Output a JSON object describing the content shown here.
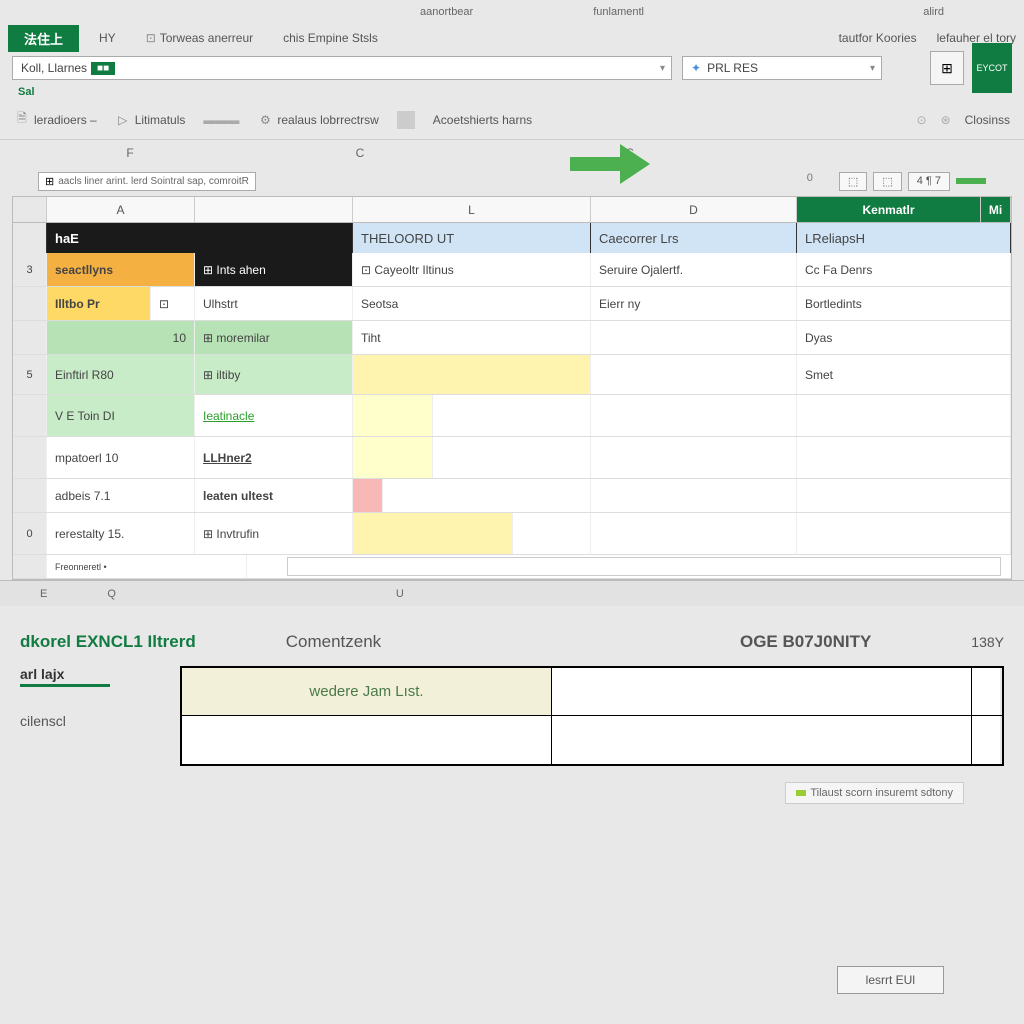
{
  "topTabs": {
    "t1": "",
    "t2": "",
    "t3": "aanortbear",
    "t4": "funlamentl",
    "t5": "",
    "t6": "alird"
  },
  "ribbon": {
    "file": "法住上",
    "tab1": "HY",
    "tab2": "Torweas anerreur",
    "tab3": "chis Empine Stsls",
    "right1": "tautfor Koories",
    "right2": "lefauher el tory"
  },
  "toolbar": {
    "dd1_text": "Koll, Llarnes",
    "dd1_token": "■■",
    "dd2_icon": "✦",
    "dd2_text": "PRL RES",
    "green_btn": "EYCOT"
  },
  "small_label": "Sal",
  "secToolbar": {
    "i1": "leradioers ‒",
    "i2": "Litimatuls",
    "i3": "realaus lobrrectrsw",
    "i4": "Acoetshierts harns",
    "right1": "Closinss"
  },
  "colLetters": {
    "f": "F",
    "c": "C",
    "s": "S"
  },
  "formulaBar": {
    "fx": "⊞",
    "text": "aacls liner arint. lerd Sointral sap, comroitR",
    "mi1": "0",
    "mi2": "⬚",
    "mi3": "⬚",
    "mi4": "4 ¶ 7"
  },
  "grid": {
    "headers": {
      "a": "A",
      "b": "",
      "c": "L",
      "d": "D",
      "e": "Kenmatlr",
      "more": "Mi"
    },
    "darkRow": {
      "a": "haE"
    },
    "blueRow": {
      "c": "THELOORD UT",
      "d": "Caecorrer Lrs",
      "e": "LReliapsH"
    },
    "rows": [
      {
        "rn": "3",
        "a": "seactllyns",
        "b": "⊞ Ints ahen",
        "c": "⊡ Cayeoltr     Iltinus",
        "d": "Seruire Ojalertf.",
        "e": "Cc Fa Denrs"
      },
      {
        "rn": "",
        "a": "Illtbo Pr",
        "ab": "⊡",
        "b": "Ulhstrt",
        "c": "Seotsa",
        "d": "Eierr ny",
        "e": "Bortledints"
      },
      {
        "rn": "",
        "a": "10",
        "b": "⊞ moremilar",
        "c": "Tiht",
        "d": "",
        "e": "Dyas"
      },
      {
        "rn": "5",
        "a": "Einftirl  R80",
        "b": "⊞ iltiby",
        "c": "",
        "d": "",
        "e": "Smet"
      },
      {
        "rn": "",
        "a": "V E Toin   DI",
        "b": "Ieatinacle",
        "c": "",
        "d": "",
        "e": ""
      },
      {
        "rn": "",
        "a": "mpatoerl 10",
        "b": "LLHner2",
        "c": "",
        "d": "",
        "e": ""
      },
      {
        "rn": "",
        "a": "adbeis 7.1",
        "b": "leaten ultest",
        "c": "",
        "d": "",
        "e": ""
      },
      {
        "rn": "0",
        "a": "rerestalty   15.",
        "b": "⊞ Invtrufin",
        "c": "",
        "d": "",
        "e": ""
      }
    ],
    "footer_text": "Freonneretl •"
  },
  "sheetTabs": {
    "t1": "E",
    "t2": "Q",
    "t3": "U"
  },
  "lower": {
    "title1": "dkorel EXNCL1 Iltrerd",
    "title2": "Comentzenk",
    "title3": "OGE B07J0NITY",
    "val": "138Y",
    "leftLabel1": "arl lajx",
    "leftLabel2": "cilenscl",
    "gridCell": "wedere Jam Lıst.",
    "note": "Tilaust scorn insuremt sdtony",
    "button": "lesrrt EUl"
  }
}
